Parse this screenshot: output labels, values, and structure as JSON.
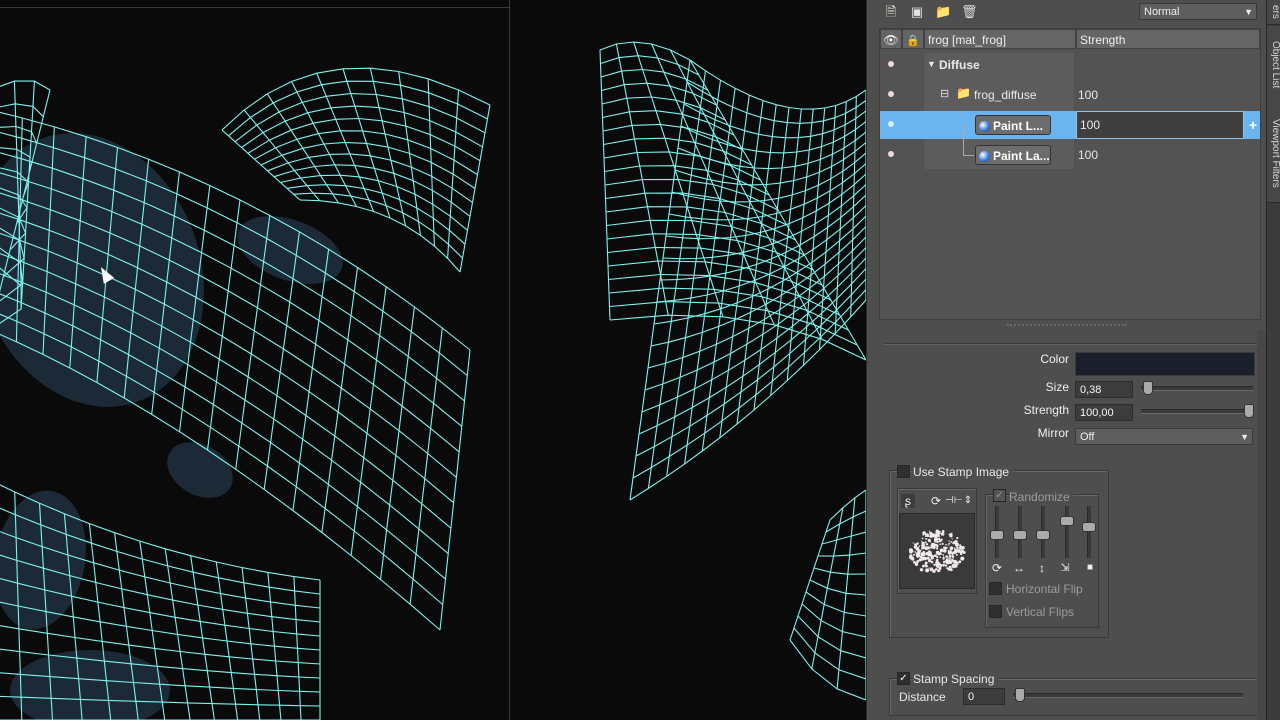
{
  "toolbar": {
    "icons": [
      "new-layer-icon",
      "new-group-icon",
      "folder-icon",
      "trash-icon"
    ],
    "blend_mode": "Normal"
  },
  "side_tabs": [
    "ers",
    "Object List",
    "Viewport Filters"
  ],
  "layers": {
    "header_name": "frog [mat_frog]",
    "header_strength": "Strength",
    "rows": [
      {
        "name": "Diffuse",
        "strength": ""
      },
      {
        "name": "frog_diffuse",
        "strength": "100"
      },
      {
        "name": "Paint L...",
        "strength": "100"
      },
      {
        "name": "Paint La...",
        "strength": "100"
      }
    ],
    "add_symbol": "+"
  },
  "brush": {
    "color_label": "Color",
    "color_value": "#1b1f2b",
    "size_label": "Size",
    "size_value": "0,38",
    "strength_label": "Strength",
    "strength_value": "100,00",
    "mirror_label": "Mirror",
    "mirror_value": "Off"
  },
  "stamp": {
    "use_stamp_label": "Use Stamp Image",
    "randomize_label": "Randomize",
    "horizontal_flip_label": "Horizontal Flip",
    "vertical_flips_label": "Vertical Flips",
    "stamp_spacing_label": "Stamp Spacing",
    "distance_label": "Distance",
    "distance_value": "0"
  }
}
